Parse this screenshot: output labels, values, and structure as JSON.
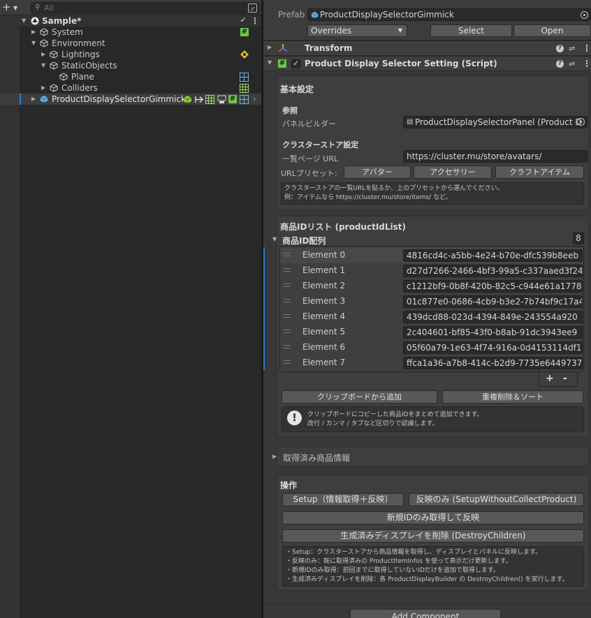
{
  "hierarchy": {
    "search_placeholder": "All",
    "scene": "Sample*",
    "items": [
      {
        "label": "System"
      },
      {
        "label": "Environment"
      },
      {
        "label": "Lightings"
      },
      {
        "label": "StaticObjects"
      },
      {
        "label": "Plane"
      },
      {
        "label": "Colliders"
      },
      {
        "label": "ProductDisplaySelectorGimmick"
      }
    ]
  },
  "inspector": {
    "prefab_label": "Prefab",
    "prefab_name": "ProductDisplaySelectorGimmick",
    "overrides_label": "Overrides",
    "select_label": "Select",
    "open_label": "Open",
    "transform_title": "Transform",
    "script_title": "Product Display Selector Setting (Script)",
    "basic": {
      "header": "基本設定",
      "ref_header": "参照",
      "panel_builder_label": "パネルビルダー",
      "panel_builder_value": "ProductDisplaySelectorPanel (Product D",
      "store_header": "クラスターストア設定",
      "list_url_label": "一覧ページ URL",
      "list_url_value": "https://cluster.mu/store/avatars/",
      "preset_label": "URLプリセット:",
      "preset_buttons": [
        "アバター",
        "アクセサリー",
        "クラフトアイテム"
      ],
      "help_line1": "クラスターストアの一覧URLを貼るか、上のプリセットから選んでください。",
      "help_line2": "例：アイテムなら https://cluster.mu/store/items/ など。"
    },
    "idlist": {
      "header": "商品IDリスト (productIdList)",
      "array_label": "商品ID配列",
      "count": "8",
      "elements": [
        {
          "label": "Element 0",
          "value": "4816cd4c-a5bb-4e24-b70e-dfc539b8eeb"
        },
        {
          "label": "Element 1",
          "value": "d27d7266-2466-4bf3-99a5-c337aaed3f24"
        },
        {
          "label": "Element 2",
          "value": "c1212bf9-0b8f-420b-82c5-c944e61a1778"
        },
        {
          "label": "Element 3",
          "value": "01c877e0-0686-4cb9-b3e2-7b74bf9c17a4"
        },
        {
          "label": "Element 4",
          "value": "439dcd88-023d-4394-849e-243554a920"
        },
        {
          "label": "Element 5",
          "value": "2c404601-bf85-43f0-b8ab-91dc3943ee9"
        },
        {
          "label": "Element 6",
          "value": "05f60a79-1e63-4f74-916a-0d4153114df1"
        },
        {
          "label": "Element 7",
          "value": "ffca1a36-a7b8-414c-b2d9-7735e6449737"
        }
      ],
      "plus": "+",
      "minus": "-",
      "paste_button": "クリップボードから追加",
      "dedupe_button": "重複削除＆ソート",
      "help_line1": "クリップボードにコピーした商品IDをまとめて追加できます。",
      "help_line2": "改行 / カンマ / タブなど区切りで認識します。"
    },
    "fetched": {
      "header": "取得済み商品情報"
    },
    "operations": {
      "header": "操作",
      "setup_button": "Setup（情報取得＋反映）",
      "setup_without_button": "反映のみ (SetupWithoutCollectProduct)",
      "new_only_button": "新規IDのみ取得して反映",
      "destroy_button": "生成済みディスプレイを削除 (DestroyChildren)",
      "help_lines": [
        "・Setup：クラスターストアから商品情報を取得し、ディスプレイとパネルに反映します。",
        "・反映のみ：既に取得済みの ProductItemInfos を使って表示だけ更新します。",
        "・新規IDのみ取得：前回までに取得していないIDだけを追加で取得します。",
        "・生成済みディスプレイを削除：各 ProductDisplayBuilder の DestroyChildren() を実行します。"
      ]
    },
    "add_component": "Add Component"
  },
  "colors": {
    "accent": "#2c7ad8",
    "prefab_blue": "#5ab4f0",
    "script_green": "#6ac84a"
  }
}
